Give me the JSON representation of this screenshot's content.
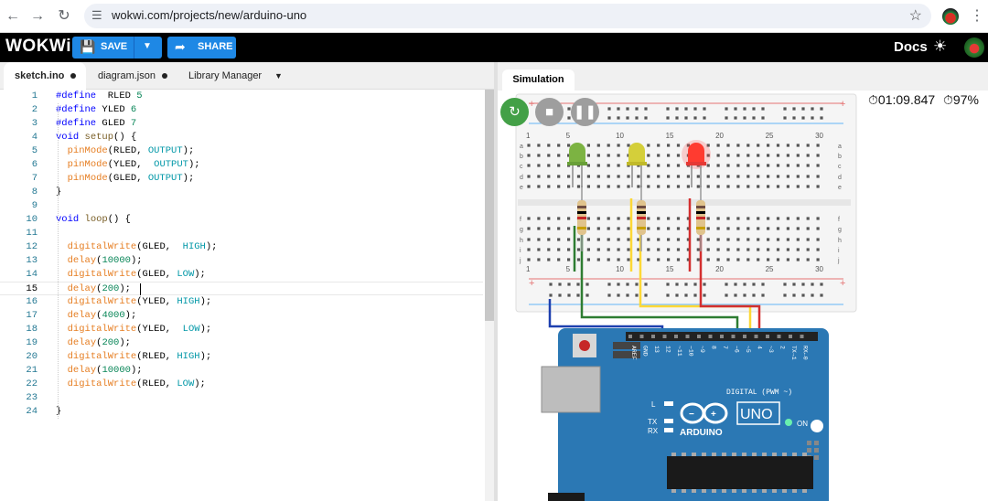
{
  "browser": {
    "url": "wokwi.com/projects/new/arduino-uno",
    "back_icon": "arrow-left-icon",
    "forward_icon": "arrow-right-icon",
    "reload_icon": "reload-icon"
  },
  "app": {
    "logo": "WOKWi",
    "save_label": "SAVE",
    "share_label": "SHARE",
    "docs_label": "Docs",
    "accent": "#1e88e5"
  },
  "editor": {
    "tabs": [
      {
        "label": "sketch.ino",
        "active": true,
        "modified": true
      },
      {
        "label": "diagram.json",
        "active": false,
        "modified": true
      },
      {
        "label": "Library Manager",
        "active": false,
        "modified": false
      }
    ],
    "lines": [
      {
        "n": "1",
        "text": "#define  RLED 5"
      },
      {
        "n": "2",
        "text": "#define YLED 6"
      },
      {
        "n": "3",
        "text": "#define GLED 7"
      },
      {
        "n": "4",
        "text": "void setup() {"
      },
      {
        "n": "5",
        "text": "  pinMode(RLED, OUTPUT);"
      },
      {
        "n": "6",
        "text": "  pinMode(YLED,  OUTPUT);"
      },
      {
        "n": "7",
        "text": "  pinMode(GLED, OUTPUT);"
      },
      {
        "n": "8",
        "text": "}"
      },
      {
        "n": "9",
        "text": ""
      },
      {
        "n": "10",
        "text": "void loop() {"
      },
      {
        "n": "11",
        "text": ""
      },
      {
        "n": "12",
        "text": "  digitalWrite(GLED,  HIGH);"
      },
      {
        "n": "13",
        "text": "  delay(10000);"
      },
      {
        "n": "14",
        "text": "  digitalWrite(GLED, LOW);"
      },
      {
        "n": "15",
        "text": "  delay(200);"
      },
      {
        "n": "16",
        "text": "  digitalWrite(YLED, HIGH);"
      },
      {
        "n": "17",
        "text": "  delay(4000);"
      },
      {
        "n": "18",
        "text": "  digitalWrite(YLED,  LOW);"
      },
      {
        "n": "19",
        "text": "  delay(200);"
      },
      {
        "n": "20",
        "text": "  digitalWrite(RLED, HIGH);"
      },
      {
        "n": "21",
        "text": "  delay(10000);"
      },
      {
        "n": "22",
        "text": "  digitalWrite(RLED, LOW);"
      },
      {
        "n": "23",
        "text": ""
      },
      {
        "n": "24",
        "text": "}"
      }
    ],
    "current_line": "15"
  },
  "simulation": {
    "tab_label": "Simulation",
    "elapsed": "01:09.847",
    "performance": "97%",
    "controls": [
      "restart-icon",
      "stop-icon",
      "pause-icon"
    ],
    "breadboard_cols_top": [
      "1",
      "5",
      "10",
      "15",
      "20",
      "25",
      "30"
    ],
    "breadboard_rows": [
      "a",
      "b",
      "c",
      "d",
      "e",
      "f",
      "g",
      "h",
      "i",
      "j"
    ],
    "leds": [
      {
        "color": "green",
        "lit": false
      },
      {
        "color": "yellow",
        "lit": false
      },
      {
        "color": "red",
        "lit": true
      }
    ],
    "board": {
      "name": "UNO",
      "brand": "ARDUINO",
      "digital_label": "DIGITAL (PWM ~)",
      "on_label": "ON",
      "l_label": "L",
      "tx_label": "TX",
      "rx_label": "RX",
      "pin_labels": [
        "AREF",
        "GND",
        "13",
        "12",
        "~11",
        "~10",
        "~9",
        "8",
        "7",
        "~6",
        "~5",
        "4",
        "~3",
        "2",
        "TX→1",
        "RX←0"
      ]
    }
  }
}
